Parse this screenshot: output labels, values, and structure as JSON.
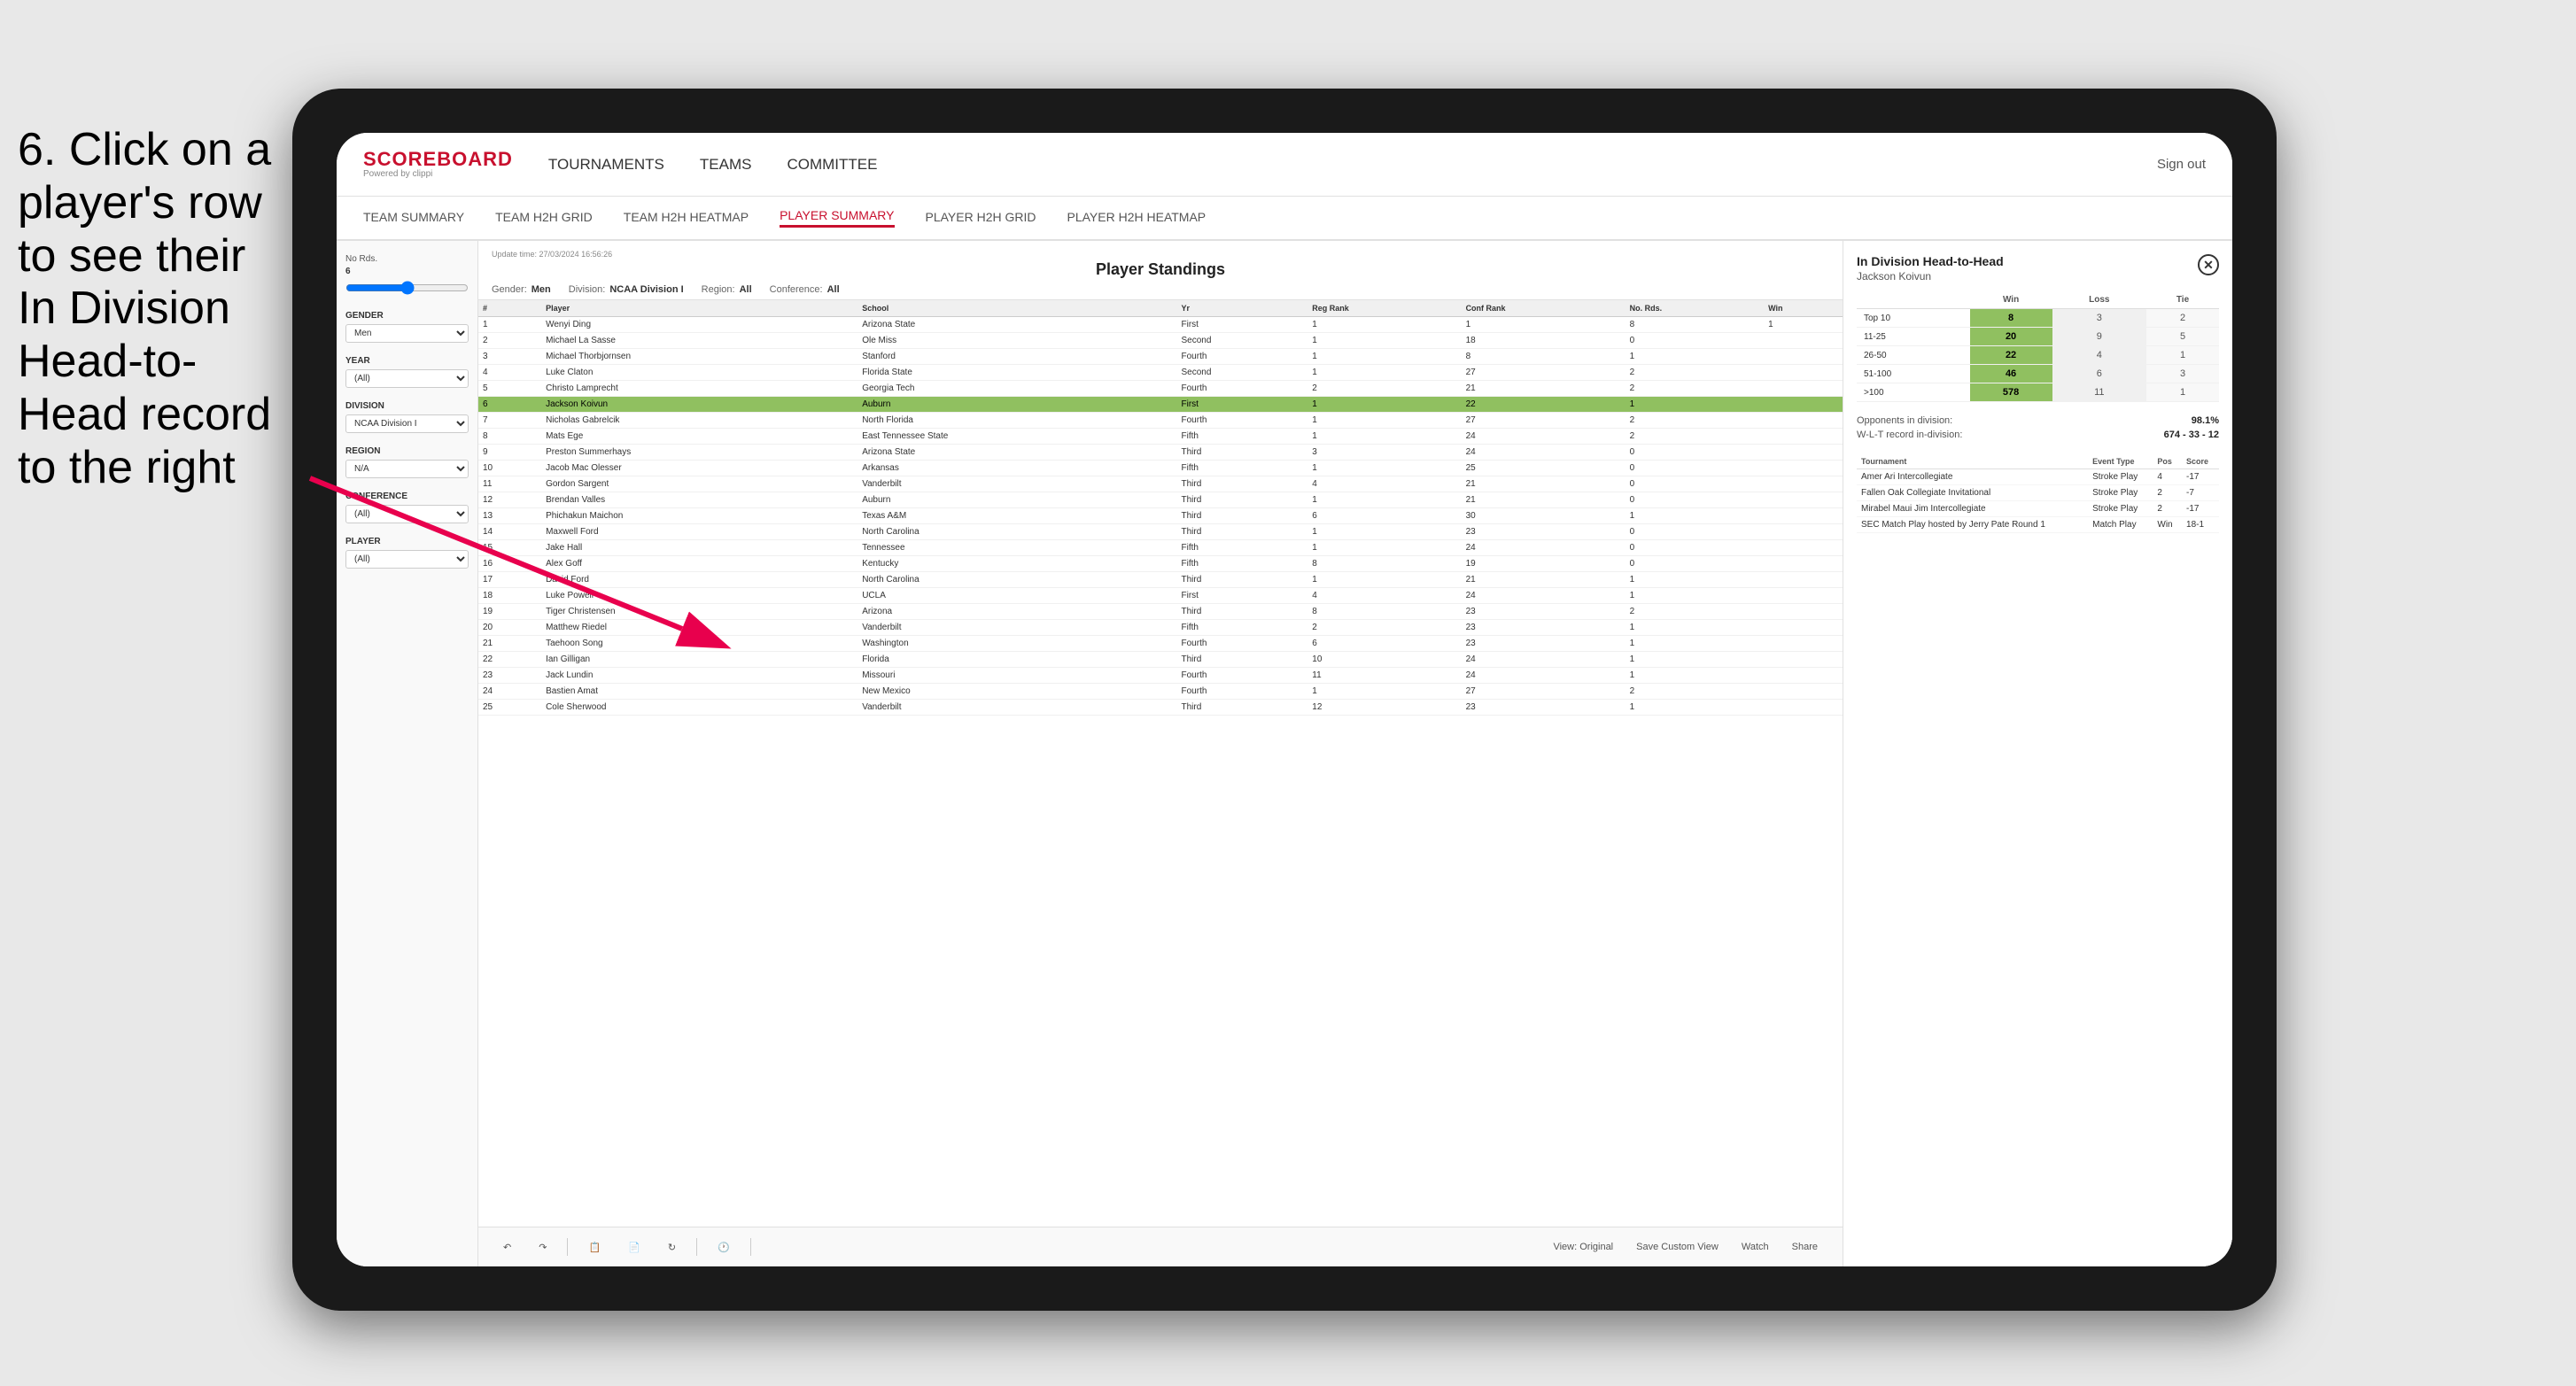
{
  "instruction": {
    "text": "6. Click on a player's row to see their In Division Head-to-Head record to the right"
  },
  "nav": {
    "logo": "SCOREBOARD",
    "logo_sub": "Powered by clippi",
    "items": [
      "TOURNAMENTS",
      "TEAMS",
      "COMMITTEE"
    ],
    "sign_out": "Sign out"
  },
  "sub_nav": {
    "items": [
      "TEAM SUMMARY",
      "TEAM H2H GRID",
      "TEAM H2H HEATMAP",
      "PLAYER SUMMARY",
      "PLAYER H2H GRID",
      "PLAYER H2H HEATMAP"
    ],
    "active": "PLAYER SUMMARY"
  },
  "filters": {
    "update_time_label": "Update time:",
    "update_time_value": "27/03/2024 16:56:26",
    "no_rds_label": "No Rds.",
    "no_rds_value": "6",
    "no_rds_sub": "6",
    "gender_label": "Gender",
    "gender_value": "Men",
    "year_label": "Year",
    "year_value": "(All)",
    "division_label": "Division",
    "division_value": "NCAA Division I",
    "region_label": "Region",
    "region_value": "N/A",
    "conference_label": "Conference",
    "conference_value": "(All)",
    "player_label": "Player",
    "player_value": "(All)"
  },
  "standings": {
    "title": "Player Standings",
    "gender_label": "Gender:",
    "gender_value": "Men",
    "division_label": "Division:",
    "division_value": "NCAA Division I",
    "region_label": "Region:",
    "region_value": "All",
    "conference_label": "Conference:",
    "conference_value": "All",
    "columns": [
      "#",
      "Player",
      "School",
      "Yr",
      "Reg Rank",
      "Conf Rank",
      "No. Rds.",
      "Win"
    ],
    "rows": [
      {
        "num": 1,
        "player": "Wenyi Ding",
        "school": "Arizona State",
        "yr": "First",
        "reg": 1,
        "conf": 1,
        "rds": 8,
        "win": 1
      },
      {
        "num": 2,
        "player": "Michael La Sasse",
        "school": "Ole Miss",
        "yr": "Second",
        "reg": 1,
        "conf": 18,
        "rds": 0
      },
      {
        "num": 3,
        "player": "Michael Thorbjornsen",
        "school": "Stanford",
        "yr": "Fourth",
        "reg": 1,
        "conf": 8,
        "rds": 1
      },
      {
        "num": 4,
        "player": "Luke Claton",
        "school": "Florida State",
        "yr": "Second",
        "reg": 1,
        "conf": 27,
        "rds": 2
      },
      {
        "num": 5,
        "player": "Christo Lamprecht",
        "school": "Georgia Tech",
        "yr": "Fourth",
        "reg": 2,
        "conf": 21,
        "rds": 2
      },
      {
        "num": 6,
        "player": "Jackson Koivun",
        "school": "Auburn",
        "yr": "First",
        "reg": 1,
        "conf": 22,
        "rds": 1,
        "highlighted": true
      },
      {
        "num": 7,
        "player": "Nicholas Gabrelcik",
        "school": "North Florida",
        "yr": "Fourth",
        "reg": 1,
        "conf": 27,
        "rds": 2
      },
      {
        "num": 8,
        "player": "Mats Ege",
        "school": "East Tennessee State",
        "yr": "Fifth",
        "reg": 1,
        "conf": 24,
        "rds": 2
      },
      {
        "num": 9,
        "player": "Preston Summerhays",
        "school": "Arizona State",
        "yr": "Third",
        "reg": 3,
        "conf": 24,
        "rds": 0
      },
      {
        "num": 10,
        "player": "Jacob Mac Olesser",
        "school": "Arkansas",
        "yr": "Fifth",
        "reg": 1,
        "conf": 25,
        "rds": 0
      },
      {
        "num": 11,
        "player": "Gordon Sargent",
        "school": "Vanderbilt",
        "yr": "Third",
        "reg": 4,
        "conf": 21,
        "rds": 0
      },
      {
        "num": 12,
        "player": "Brendan Valles",
        "school": "Auburn",
        "yr": "Third",
        "reg": 1,
        "conf": 21,
        "rds": 0
      },
      {
        "num": 13,
        "player": "Phichakun Maichon",
        "school": "Texas A&M",
        "yr": "Third",
        "reg": 6,
        "conf": 30,
        "rds": 1
      },
      {
        "num": 14,
        "player": "Maxwell Ford",
        "school": "North Carolina",
        "yr": "Third",
        "reg": 1,
        "conf": 23,
        "rds": 0
      },
      {
        "num": 15,
        "player": "Jake Hall",
        "school": "Tennessee",
        "yr": "Fifth",
        "reg": 1,
        "conf": 24,
        "rds": 0
      },
      {
        "num": 16,
        "player": "Alex Goff",
        "school": "Kentucky",
        "yr": "Fifth",
        "reg": 8,
        "conf": 19,
        "rds": 0
      },
      {
        "num": 17,
        "player": "David Ford",
        "school": "North Carolina",
        "yr": "Third",
        "reg": 1,
        "conf": 21,
        "rds": 1
      },
      {
        "num": 18,
        "player": "Luke Powell",
        "school": "UCLA",
        "yr": "First",
        "reg": 4,
        "conf": 24,
        "rds": 1
      },
      {
        "num": 19,
        "player": "Tiger Christensen",
        "school": "Arizona",
        "yr": "Third",
        "reg": 8,
        "conf": 23,
        "rds": 2
      },
      {
        "num": 20,
        "player": "Matthew Riedel",
        "school": "Vanderbilt",
        "yr": "Fifth",
        "reg": 2,
        "conf": 23,
        "rds": 1
      },
      {
        "num": 21,
        "player": "Taehoon Song",
        "school": "Washington",
        "yr": "Fourth",
        "reg": 6,
        "conf": 23,
        "rds": 1
      },
      {
        "num": 22,
        "player": "Ian Gilligan",
        "school": "Florida",
        "yr": "Third",
        "reg": 10,
        "conf": 24,
        "rds": 1
      },
      {
        "num": 23,
        "player": "Jack Lundin",
        "school": "Missouri",
        "yr": "Fourth",
        "reg": 11,
        "conf": 24,
        "rds": 1
      },
      {
        "num": 24,
        "player": "Bastien Amat",
        "school": "New Mexico",
        "yr": "Fourth",
        "reg": 1,
        "conf": 27,
        "rds": 2
      },
      {
        "num": 25,
        "player": "Cole Sherwood",
        "school": "Vanderbilt",
        "yr": "Third",
        "reg": 12,
        "conf": 23,
        "rds": 1
      }
    ]
  },
  "h2h": {
    "title": "In Division Head-to-Head",
    "player_name": "Jackson Koivun",
    "table": {
      "columns": [
        "",
        "Win",
        "Loss",
        "Tie"
      ],
      "rows": [
        {
          "rank": "Top 10",
          "win": 8,
          "loss": 3,
          "tie": 2
        },
        {
          "rank": "11-25",
          "win": 20,
          "loss": 9,
          "tie": 5
        },
        {
          "rank": "26-50",
          "win": 22,
          "loss": 4,
          "tie": 1
        },
        {
          "rank": "51-100",
          "win": 46,
          "loss": 6,
          "tie": 3
        },
        {
          "rank": ">100",
          "win": 578,
          "loss": 11,
          "tie": 1
        }
      ]
    },
    "opponents_label": "Opponents in division:",
    "opponents_value": "98.1%",
    "wlt_label": "W-L-T record in-division:",
    "wlt_value": "674 - 33 - 12",
    "tournament_columns": [
      "Tournament",
      "Event Type",
      "Pos",
      "Score"
    ],
    "tournaments": [
      {
        "name": "Amer Ari Intercollegiate",
        "type": "Stroke Play",
        "pos": 4,
        "score": "-17"
      },
      {
        "name": "Fallen Oak Collegiate Invitational",
        "type": "Stroke Play",
        "pos": 2,
        "score": "-7"
      },
      {
        "name": "Mirabel Maui Jim Intercollegiate",
        "type": "Stroke Play",
        "pos": 2,
        "score": "-17"
      },
      {
        "name": "SEC Match Play hosted by Jerry Pate Round 1",
        "type": "Match Play",
        "pos": "Win",
        "score": "18-1"
      }
    ]
  },
  "toolbar": {
    "view_original": "View: Original",
    "save_custom": "Save Custom View",
    "watch": "Watch",
    "share": "Share"
  }
}
